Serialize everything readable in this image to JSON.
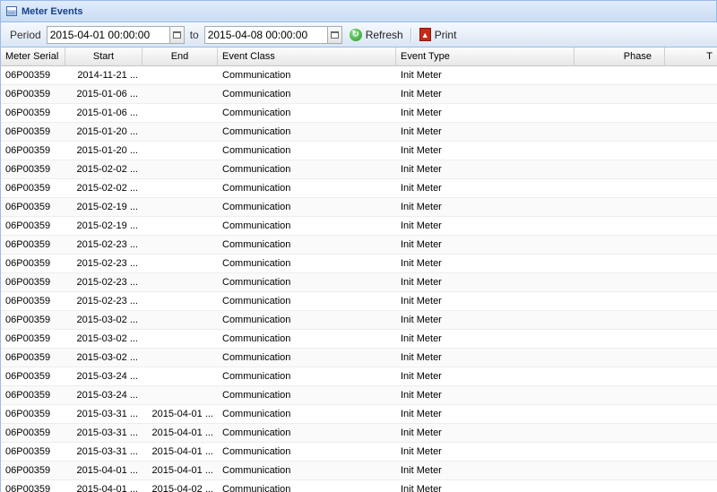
{
  "panel": {
    "title": "Meter Events",
    "icon": "table-icon"
  },
  "toolbar": {
    "period_label": "Period",
    "from_value": "2015-04-01 00:00:00",
    "to_label": "to",
    "to_value": "2015-04-08 00:00:00",
    "refresh_label": "Refresh",
    "print_label": "Print"
  },
  "grid": {
    "columns": [
      "Meter Serial",
      "Start",
      "End",
      "Event Class",
      "Event Type",
      "Phase",
      "T"
    ],
    "rows": [
      [
        "06P00359",
        "2014-11-21 ...",
        "",
        "Communication",
        "Init Meter"
      ],
      [
        "06P00359",
        "2015-01-06 ...",
        "",
        "Communication",
        "Init Meter"
      ],
      [
        "06P00359",
        "2015-01-06 ...",
        "",
        "Communication",
        "Init Meter"
      ],
      [
        "06P00359",
        "2015-01-20 ...",
        "",
        "Communication",
        "Init Meter"
      ],
      [
        "06P00359",
        "2015-01-20 ...",
        "",
        "Communication",
        "Init Meter"
      ],
      [
        "06P00359",
        "2015-02-02 ...",
        "",
        "Communication",
        "Init Meter"
      ],
      [
        "06P00359",
        "2015-02-02 ...",
        "",
        "Communication",
        "Init Meter"
      ],
      [
        "06P00359",
        "2015-02-19 ...",
        "",
        "Communication",
        "Init Meter"
      ],
      [
        "06P00359",
        "2015-02-19 ...",
        "",
        "Communication",
        "Init Meter"
      ],
      [
        "06P00359",
        "2015-02-23 ...",
        "",
        "Communication",
        "Init Meter"
      ],
      [
        "06P00359",
        "2015-02-23 ...",
        "",
        "Communication",
        "Init Meter"
      ],
      [
        "06P00359",
        "2015-02-23 ...",
        "",
        "Communication",
        "Init Meter"
      ],
      [
        "06P00359",
        "2015-02-23 ...",
        "",
        "Communication",
        "Init Meter"
      ],
      [
        "06P00359",
        "2015-03-02 ...",
        "",
        "Communication",
        "Init Meter"
      ],
      [
        "06P00359",
        "2015-03-02 ...",
        "",
        "Communication",
        "Init Meter"
      ],
      [
        "06P00359",
        "2015-03-02 ...",
        "",
        "Communication",
        "Init Meter"
      ],
      [
        "06P00359",
        "2015-03-24 ...",
        "",
        "Communication",
        "Init Meter"
      ],
      [
        "06P00359",
        "2015-03-24 ...",
        "",
        "Communication",
        "Init Meter"
      ],
      [
        "06P00359",
        "2015-03-31 ...",
        "2015-04-01 ...",
        "Communication",
        "Init Meter"
      ],
      [
        "06P00359",
        "2015-03-31 ...",
        "2015-04-01 ...",
        "Communication",
        "Init Meter"
      ],
      [
        "06P00359",
        "2015-03-31 ...",
        "2015-04-01 ...",
        "Communication",
        "Init Meter"
      ],
      [
        "06P00359",
        "2015-04-01 ...",
        "2015-04-01 ...",
        "Communication",
        "Init Meter"
      ],
      [
        "06P00359",
        "2015-04-01 ...",
        "2015-04-02 ...",
        "Communication",
        "Init Meter"
      ]
    ]
  }
}
